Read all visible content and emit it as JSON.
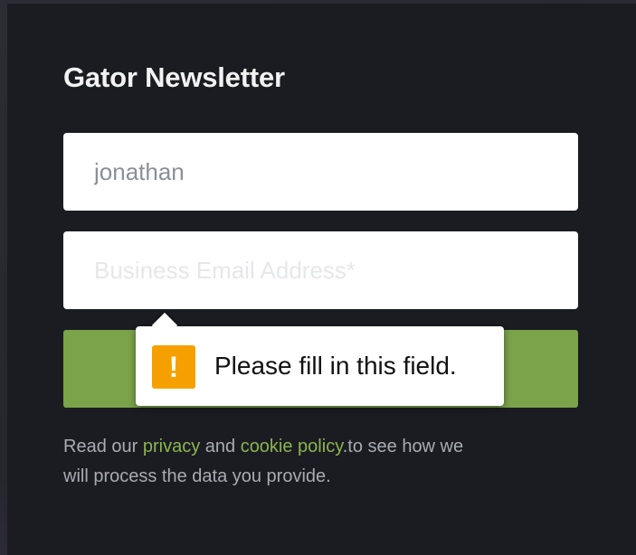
{
  "form": {
    "title": "Gator Newsletter",
    "name_value": "jonathan",
    "email_placeholder": "Business Email Address*"
  },
  "validation": {
    "icon": "warning-icon",
    "message": "Please fill in this field."
  },
  "footer": {
    "text_before": "Read our ",
    "privacy_link": "privacy",
    "and": " and ",
    "cookie_link": "cookie policy",
    "text_after": ".to see how we will process the data you provide."
  },
  "colors": {
    "background": "#1a1c21",
    "accent": "#7aa34a",
    "link": "#8cb450",
    "warning": "#f5a000"
  }
}
